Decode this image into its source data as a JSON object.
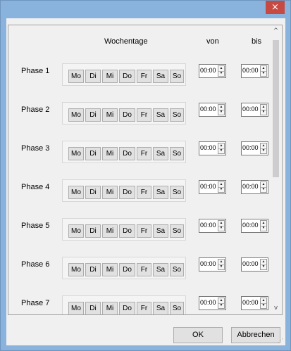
{
  "window": {
    "close_symbol": "×"
  },
  "headers": {
    "days": "Wochentage",
    "from": "von",
    "to": "bis"
  },
  "days": [
    "Mo",
    "Di",
    "Mi",
    "Do",
    "Fr",
    "Sa",
    "So"
  ],
  "phases": [
    {
      "label": "Phase 1",
      "von": "00:00",
      "bis": "00:00"
    },
    {
      "label": "Phase 2",
      "von": "00:00",
      "bis": "00:00"
    },
    {
      "label": "Phase 3",
      "von": "00:00",
      "bis": "00:00"
    },
    {
      "label": "Phase 4",
      "von": "00:00",
      "bis": "00:00"
    },
    {
      "label": "Phase 5",
      "von": "00:00",
      "bis": "00:00"
    },
    {
      "label": "Phase 6",
      "von": "00:00",
      "bis": "00:00"
    },
    {
      "label": "Phase 7",
      "von": "00:00",
      "bis": "00:00"
    }
  ],
  "scrollbar": {
    "up_symbol": "^",
    "down_symbol": "v"
  },
  "buttons": {
    "ok": "OK",
    "cancel": "Abbrechen"
  },
  "colors": {
    "close_button": "#c74a42",
    "title_bar": "#89b2dc"
  }
}
